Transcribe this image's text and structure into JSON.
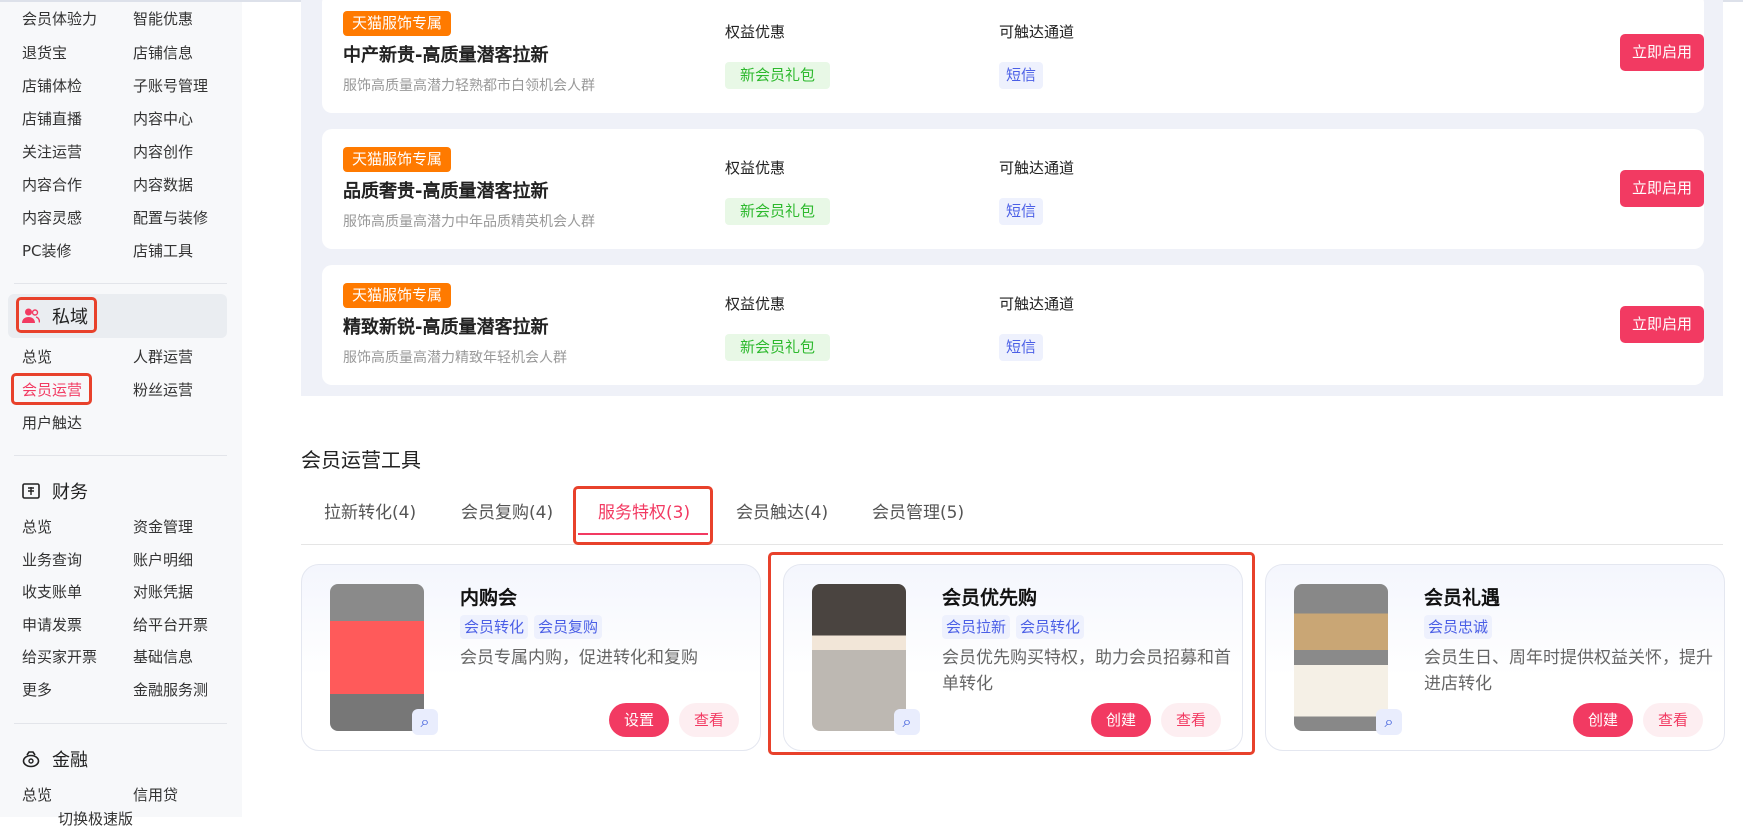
{
  "colors": {
    "accent": "#f23a62",
    "tag_orange": "#ff7a00",
    "green": "#2db92d",
    "blue": "#4b5fe6",
    "highlight_box": "#e8412b"
  },
  "sidebar": {
    "top_partial": [
      "会员体验力",
      "智能优惠"
    ],
    "shop_items": [
      [
        "退货宝",
        "店铺信息"
      ],
      [
        "店铺体检",
        "子账号管理"
      ],
      [
        "店铺直播",
        "内容中心"
      ],
      [
        "关注运营",
        "内容创作"
      ],
      [
        "内容合作",
        "内容数据"
      ],
      [
        "内容灵感",
        "配置与装修"
      ],
      [
        "PC装修",
        "店铺工具"
      ]
    ],
    "private": {
      "title": "私域",
      "icon": "users-icon",
      "items": [
        [
          "总览",
          "人群运营"
        ],
        [
          "会员运营",
          "粉丝运营"
        ],
        [
          "用户触达",
          ""
        ]
      ],
      "active": "会员运营"
    },
    "finance": {
      "title": "财务",
      "icon": "finance-icon",
      "items": [
        [
          "总览",
          "资金管理"
        ],
        [
          "业务查询",
          "账户明细"
        ],
        [
          "收支账单",
          "对账凭据"
        ],
        [
          "申请发票",
          "给平台开票"
        ],
        [
          "给买家开票",
          "基础信息"
        ],
        [
          "更多",
          "金融服务测"
        ]
      ]
    },
    "loan": {
      "title": "金融",
      "icon": "money-bag-icon",
      "items": [
        [
          "总览",
          "信用贷"
        ]
      ]
    },
    "bottom_partial": "切换极速版"
  },
  "strategies": [
    {
      "tag": "天猫服饰专属",
      "title": "中产新贵-高质量潜客拉新",
      "desc": "服饰高质量高潜力轻熟都市白领机会人群",
      "benefit_label": "权益优惠",
      "benefit": "新会员礼包",
      "channel_label": "可触达通道",
      "channel": "短信",
      "button": "立即启用"
    },
    {
      "tag": "天猫服饰专属",
      "title": "品质奢贵-高质量潜客拉新",
      "desc": "服饰高质量高潜力中年品质精英机会人群",
      "benefit_label": "权益优惠",
      "benefit": "新会员礼包",
      "channel_label": "可触达通道",
      "channel": "短信",
      "button": "立即启用"
    },
    {
      "tag": "天猫服饰专属",
      "title": "精致新锐-高质量潜客拉新",
      "desc": "服饰高质量高潜力精致年轻机会人群",
      "benefit_label": "权益优惠",
      "benefit": "新会员礼包",
      "channel_label": "可触达通道",
      "channel": "短信",
      "button": "立即启用"
    }
  ],
  "tools_section": {
    "title": "会员运营工具",
    "tabs": [
      "拉新转化(4)",
      "会员复购(4)",
      "服务特权(3)",
      "会员触达(4)",
      "会员管理(5)"
    ],
    "active_tab": "服务特权(3)",
    "cards": [
      {
        "title": "内购会",
        "tags": [
          "会员转化",
          "会员复购"
        ],
        "desc": "会员专属内购，促进转化和复购",
        "primary": "设置",
        "secondary": "查看"
      },
      {
        "title": "会员优先购",
        "tags": [
          "会员拉新",
          "会员转化"
        ],
        "desc": "会员优先购买特权，助力会员招募和首单转化",
        "primary": "创建",
        "secondary": "查看"
      },
      {
        "title": "会员礼遇",
        "tags": [
          "会员忠诚"
        ],
        "desc": "会员生日、周年时提供权益关怀，提升进店转化",
        "primary": "创建",
        "secondary": "查看"
      }
    ]
  }
}
